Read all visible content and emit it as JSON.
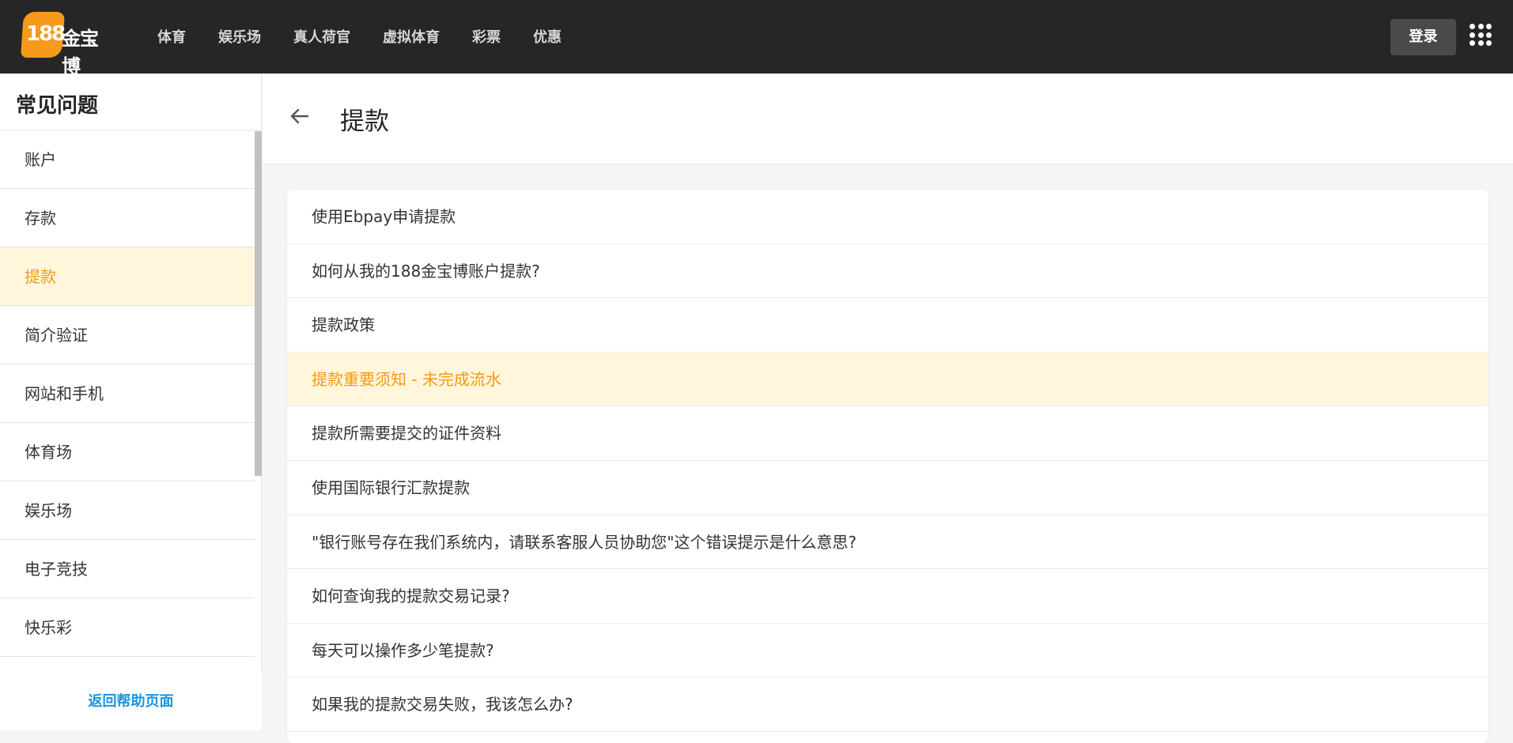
{
  "header": {
    "logo_number": "188",
    "logo_text": "金宝博",
    "nav": [
      "体育",
      "娱乐场",
      "真人荷官",
      "虚拟体育",
      "彩票",
      "优惠"
    ],
    "login_label": "登录",
    "apps_icon": "grid-dots-icon"
  },
  "sidebar": {
    "title": "常见问题",
    "items": [
      {
        "label": "账户"
      },
      {
        "label": "存款"
      },
      {
        "label": "提款"
      },
      {
        "label": "简介验证"
      },
      {
        "label": "网站和手机"
      },
      {
        "label": "体育场"
      },
      {
        "label": "娱乐场"
      },
      {
        "label": "电子竞技"
      },
      {
        "label": "快乐彩"
      }
    ],
    "active_index": 2,
    "back_link": "返回帮助页面"
  },
  "main": {
    "title": "提款",
    "back_icon": "arrow-left-icon",
    "questions": [
      {
        "label": "使用Ebpay申请提款"
      },
      {
        "label": "如何从我的188金宝博账户提款?"
      },
      {
        "label": "提款政策"
      },
      {
        "label": "提款重要须知 - 未完成流水"
      },
      {
        "label": "提款所需要提交的证件资料"
      },
      {
        "label": "使用国际银行汇款提款"
      },
      {
        "label": "\"银行账号存在我们系统内，请联系客服人员协助您\"这个错误提示是什么意思?"
      },
      {
        "label": "如何查询我的提款交易记录?"
      },
      {
        "label": "每天可以操作多少笔提款?"
      },
      {
        "label": "如果我的提款交易失败，我该怎么办?"
      }
    ],
    "active_index": 3
  },
  "colors": {
    "topbar": "#262626",
    "accent": "#f29b13",
    "active_bg": "#fff6dc",
    "link": "#1996e0",
    "logo_badge": "#f59a1b"
  }
}
